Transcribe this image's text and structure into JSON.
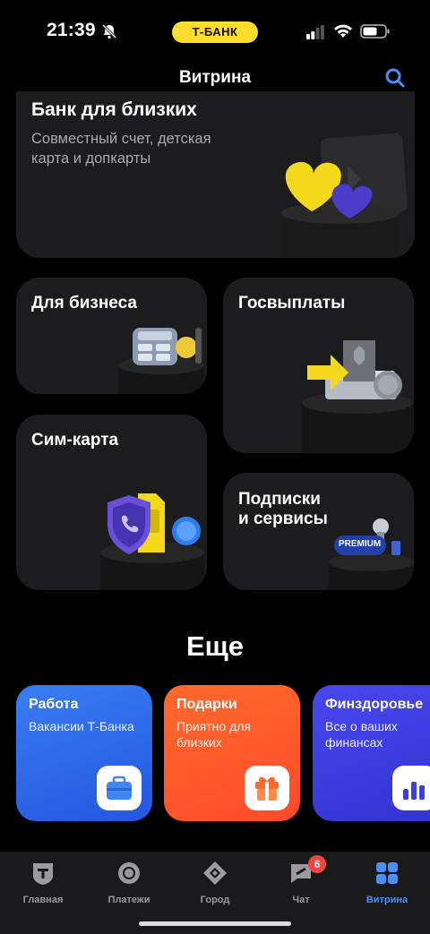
{
  "status_bar": {
    "time": "21:39",
    "brand_pill": "Т-БАНК"
  },
  "header": {
    "title": "Витрина"
  },
  "cards": {
    "family": {
      "title": "Банк для близких",
      "subtitle": "Совместный счет, детская карта и допкарты"
    },
    "business": {
      "title": "Для бизнеса"
    },
    "gov": {
      "title": "Госвыплаты"
    },
    "sim": {
      "title": "Сим-карта"
    },
    "subs": {
      "title_line1": "Подписки",
      "title_line2": "и сервисы",
      "premium_label": "PREMIUM"
    }
  },
  "more": {
    "title": "Еще",
    "items": [
      {
        "title": "Работа",
        "subtitle": "Вакансии Т-Банка",
        "color": "#2f6ff0",
        "icon": "briefcase-icon"
      },
      {
        "title": "Подарки",
        "subtitle": "Приятно для близких",
        "color": "#ff5a2a",
        "icon": "gift-icon"
      },
      {
        "title": "Финздоровье",
        "subtitle": "Все о ваших финансах",
        "color": "#3b3fe0",
        "icon": "bar-chart-icon"
      }
    ]
  },
  "tabbar": {
    "tabs": [
      {
        "label": "Главная",
        "icon": "home-shield-icon"
      },
      {
        "label": "Платежи",
        "icon": "payments-circle-icon"
      },
      {
        "label": "Город",
        "icon": "city-diamond-icon"
      },
      {
        "label": "Чат",
        "icon": "chat-icon",
        "badge": "6"
      },
      {
        "label": "Витрина",
        "icon": "showcase-grid-icon",
        "active": true
      }
    ]
  }
}
